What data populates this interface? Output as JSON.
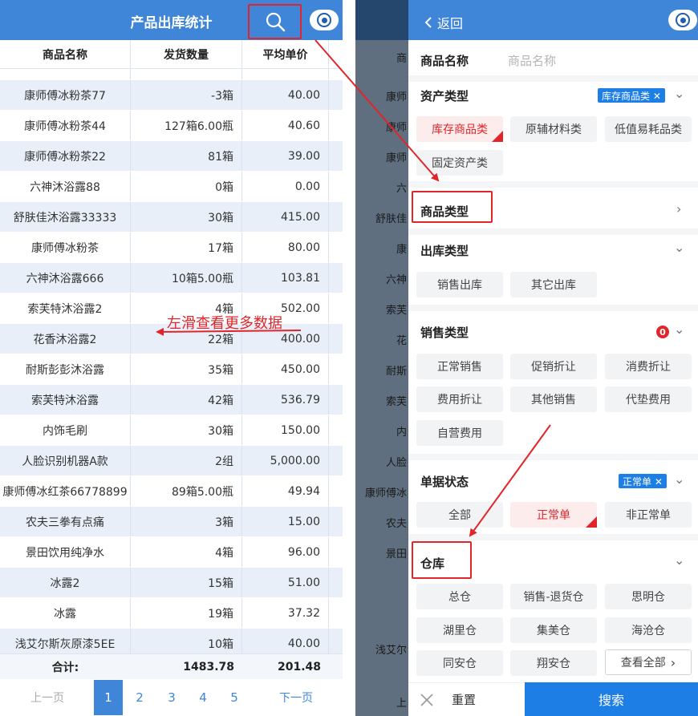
{
  "left": {
    "title": "产品出库统计",
    "columns": [
      "商品名称",
      "发货数量",
      "平均单价"
    ],
    "rows": [
      [
        "康师傅冰粉茶77",
        "-3箱",
        "40.00"
      ],
      [
        "康师傅冰粉茶44",
        "127箱6.00瓶",
        "40.60"
      ],
      [
        "康师傅冰粉茶22",
        "81箱",
        "39.00"
      ],
      [
        "六神沐浴露88",
        "0箱",
        "0.00"
      ],
      [
        "舒肤佳沐浴露33333",
        "30箱",
        "415.00"
      ],
      [
        "康师傅冰粉茶",
        "17箱",
        "80.00"
      ],
      [
        "六神沐浴露666",
        "10箱5.00瓶",
        "103.81"
      ],
      [
        "索芙特沐浴露2",
        "4箱",
        "502.00"
      ],
      [
        "花香沐浴露2",
        "22箱",
        "400.00"
      ],
      [
        "耐斯彭彭沐浴露",
        "35箱",
        "450.00"
      ],
      [
        "索芙特沐浴露",
        "42箱",
        "536.79"
      ],
      [
        "内饰毛刷",
        "30箱",
        "150.00"
      ],
      [
        "人脸识别机器A款",
        "2组",
        "5,000.00"
      ],
      [
        "康师傅冰红茶66778899",
        "89箱5.00瓶",
        "49.94"
      ],
      [
        "农夫三拳有点痛",
        "3箱",
        "15.00"
      ],
      [
        "景田饮用纯净水",
        "4箱",
        "96.00"
      ],
      [
        "冰露2",
        "15箱",
        "51.00"
      ],
      [
        "冰露",
        "19箱",
        "37.32"
      ],
      [
        "浅艾尔斯灰原漆5EE",
        "10箱",
        "40.00"
      ]
    ],
    "total": {
      "label": "合计:",
      "qty": "1483.78",
      "price": "201.48"
    },
    "pager": {
      "prev": "上一页",
      "next": "下一页",
      "pages": [
        "1",
        "2",
        "3",
        "4",
        "5"
      ],
      "active": "1"
    },
    "annotation": "左滑查看更多数据"
  },
  "right": {
    "back": "返回",
    "name_label": "商品名称",
    "name_placeholder": "商品名称",
    "asset_label": "资产类型",
    "asset_badge": "库存商品类 ✕",
    "asset_options": [
      "库存商品类",
      "原辅材料类",
      "低值易耗品类",
      "固定资产类"
    ],
    "goods_type_label": "商品类型",
    "out_type_label": "出库类型",
    "out_type_options": [
      "销售出库",
      "其它出库"
    ],
    "sale_type_label": "销售类型",
    "sale_type_count": "0",
    "sale_type_options": [
      "正常销售",
      "促销折让",
      "消费折让",
      "费用折让",
      "其他销售",
      "代垫费用",
      "自营费用"
    ],
    "status_label": "单据状态",
    "status_badge": "正常单 ✕",
    "status_options": [
      "全部",
      "正常单",
      "非正常单"
    ],
    "warehouse_label": "仓库",
    "warehouse_options": [
      "总仓",
      "销售-退货仓",
      "思明仓",
      "湖里仓",
      "集美仓",
      "海沧仓",
      "同安仓",
      "翔安仓"
    ],
    "view_all": "查看全部",
    "reset": "重置",
    "search": "搜索",
    "bg_cells": [
      "商",
      "康师",
      "康师",
      "康师",
      "六",
      "舒肤佳",
      "康",
      "六神",
      "索芙",
      "花",
      "耐斯",
      "索芙",
      "内",
      "人脸",
      "康师傅冰",
      "农夫",
      "景田",
      "浅艾尔",
      "上"
    ]
  },
  "colors": {
    "primary": "#3f86d8",
    "accent": "#e0262a",
    "badge": "#1d7ee6"
  }
}
